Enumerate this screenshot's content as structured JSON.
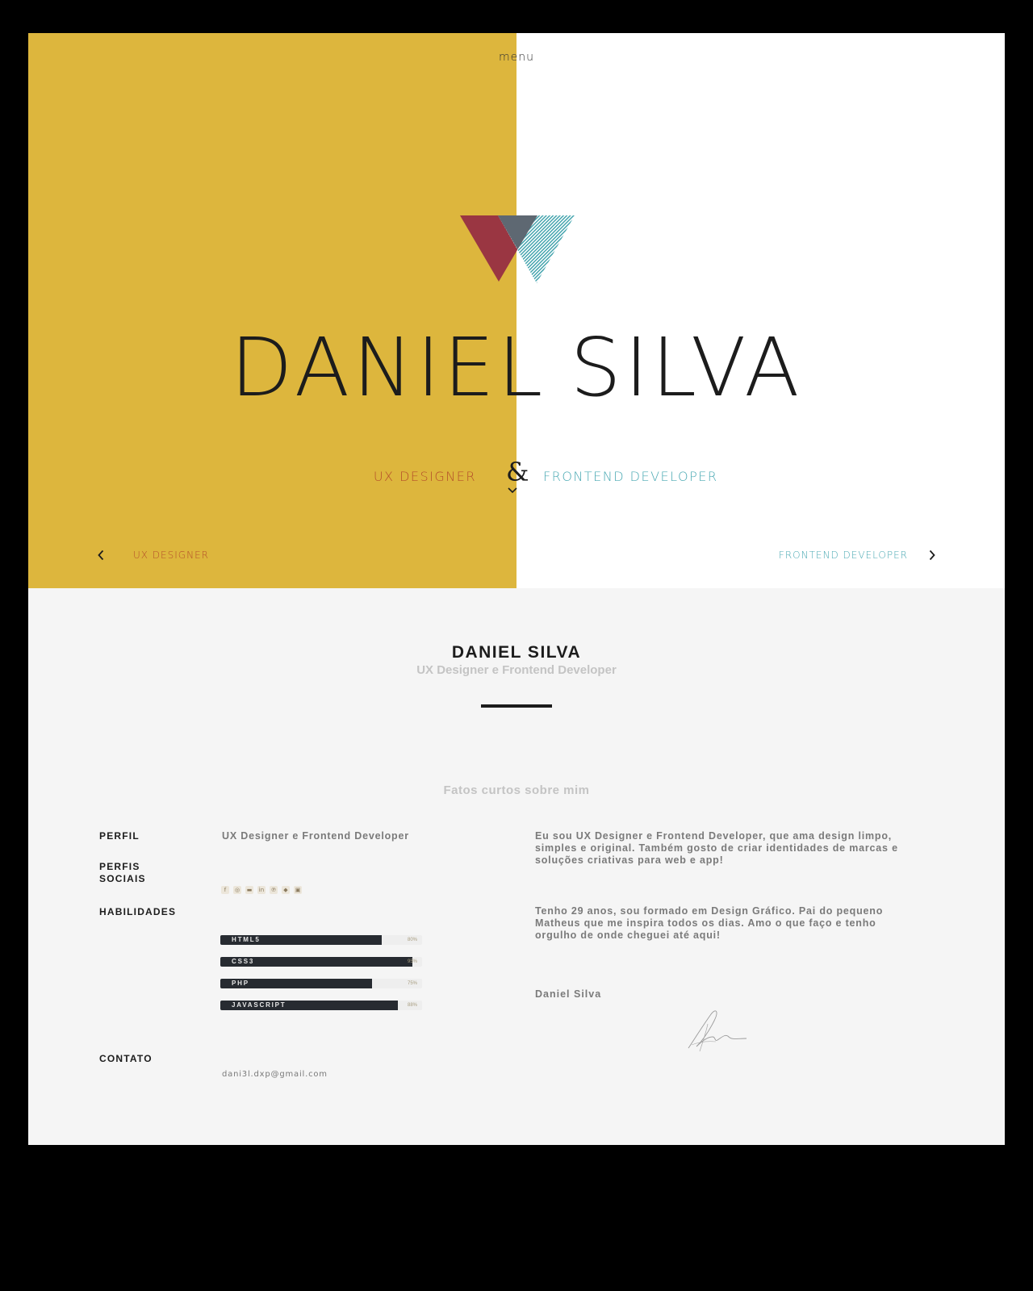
{
  "hero": {
    "menu_label": "menu",
    "first_name": "DANIEL",
    "last_name": "SILVA",
    "role_left": "UX Designer",
    "ampersand": "&",
    "role_right": "Frontend Developer",
    "nav_prev_label": "UX Designer",
    "nav_next_label": "Frontend Developer",
    "colors": {
      "left_panel": "#ddb63d",
      "right_panel": "#ffffff",
      "ux_accent": "#b5502a",
      "fe_accent": "#4aa9b3"
    },
    "icons": [
      "logo-triangles-icon",
      "chevron-down-icon",
      "chevron-left-icon",
      "chevron-right-icon"
    ]
  },
  "about": {
    "name": "DANIEL SILVA",
    "subtitle": "UX Designer e Frontend Developer",
    "facts_title": "Fatos curtos sobre mim",
    "profile_label": "PERFIL",
    "profile_value": "UX Designer e Frontend Developer",
    "social_label_line1": "PERFIS",
    "social_label_line2": "SOCIAIS",
    "social_icons": [
      {
        "name": "facebook-icon",
        "glyph": "f"
      },
      {
        "name": "dribbble-icon",
        "glyph": "◎"
      },
      {
        "name": "behance-icon",
        "glyph": "▬"
      },
      {
        "name": "linkedin-icon",
        "glyph": "in"
      },
      {
        "name": "pinterest-icon",
        "glyph": "℗"
      },
      {
        "name": "dropbox-icon",
        "glyph": "◆"
      },
      {
        "name": "instagram-icon",
        "glyph": "▣"
      }
    ],
    "skills_label": "HABILIDADES",
    "skills": [
      {
        "name": "HTML5",
        "percent": "80%",
        "value": 80
      },
      {
        "name": "CSS3",
        "percent": "95%",
        "value": 95
      },
      {
        "name": "PHP",
        "percent": "75%",
        "value": 75
      },
      {
        "name": "JAVASCRIPT",
        "percent": "88%",
        "value": 88
      }
    ],
    "contact_label": "CONTATO",
    "contact_email": "dani3l.dxp@gmail.com",
    "bio_1": "Eu sou UX Designer e Frontend Developer, que ama design limpo, simples e original. Também gosto de criar identidades de marcas e soluções criativas para web e app!",
    "bio_2": "Tenho 29 anos, sou formado em Design Gráfico. Pai do pequeno Matheus que me inspira todos os dias. Amo o que faço e tenho orgulho de onde cheguei até aqui!",
    "sign_name": "Daniel Silva",
    "colors": {
      "background": "#f5f5f5",
      "skill_bar": "#272b31",
      "muted_text": "#7a7a7a"
    }
  }
}
